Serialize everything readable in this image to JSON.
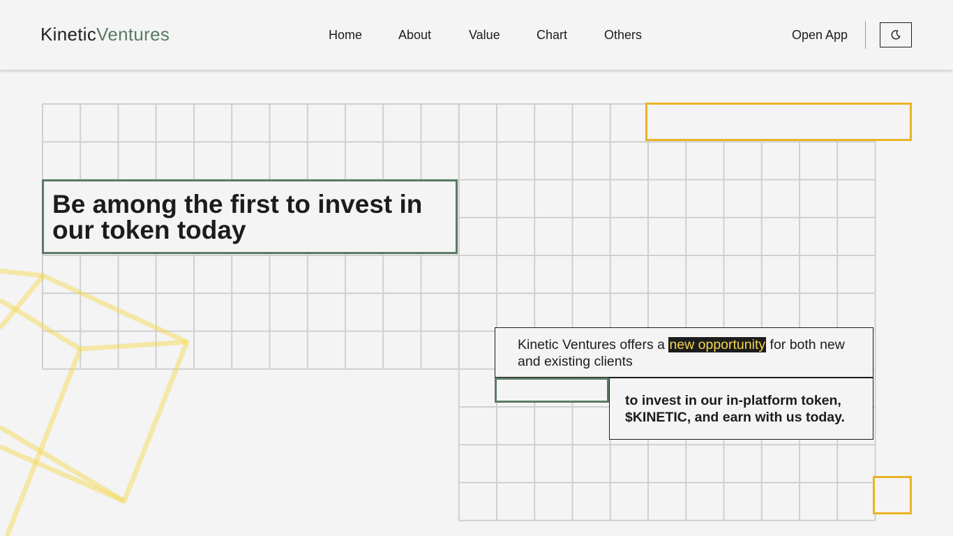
{
  "logo": {
    "part1": "Kinetic",
    "part2": "Ventures"
  },
  "nav": [
    {
      "label": "Home"
    },
    {
      "label": "About"
    },
    {
      "label": "Value"
    },
    {
      "label": "Chart"
    },
    {
      "label": "Others"
    }
  ],
  "header": {
    "open_app_label": "Open App",
    "theme_toggle_icon": "moon-icon"
  },
  "hero": {
    "title": "Be among the first to invest in our token today"
  },
  "description": {
    "before": "Kinetic Ventures offers a ",
    "highlight": "new opportunity",
    "after": " for both new and existing clients"
  },
  "cta_text": "to invest in our in-platform token, $KINETIC, and earn with us today.",
  "colors": {
    "background": "#f4f4f4",
    "brand_green": "#5a7a64",
    "accent_yellow": "#e9b324",
    "highlight_text": "#f3d74a",
    "text": "#1c1c1c",
    "grid_line": "#cfcfcf"
  }
}
